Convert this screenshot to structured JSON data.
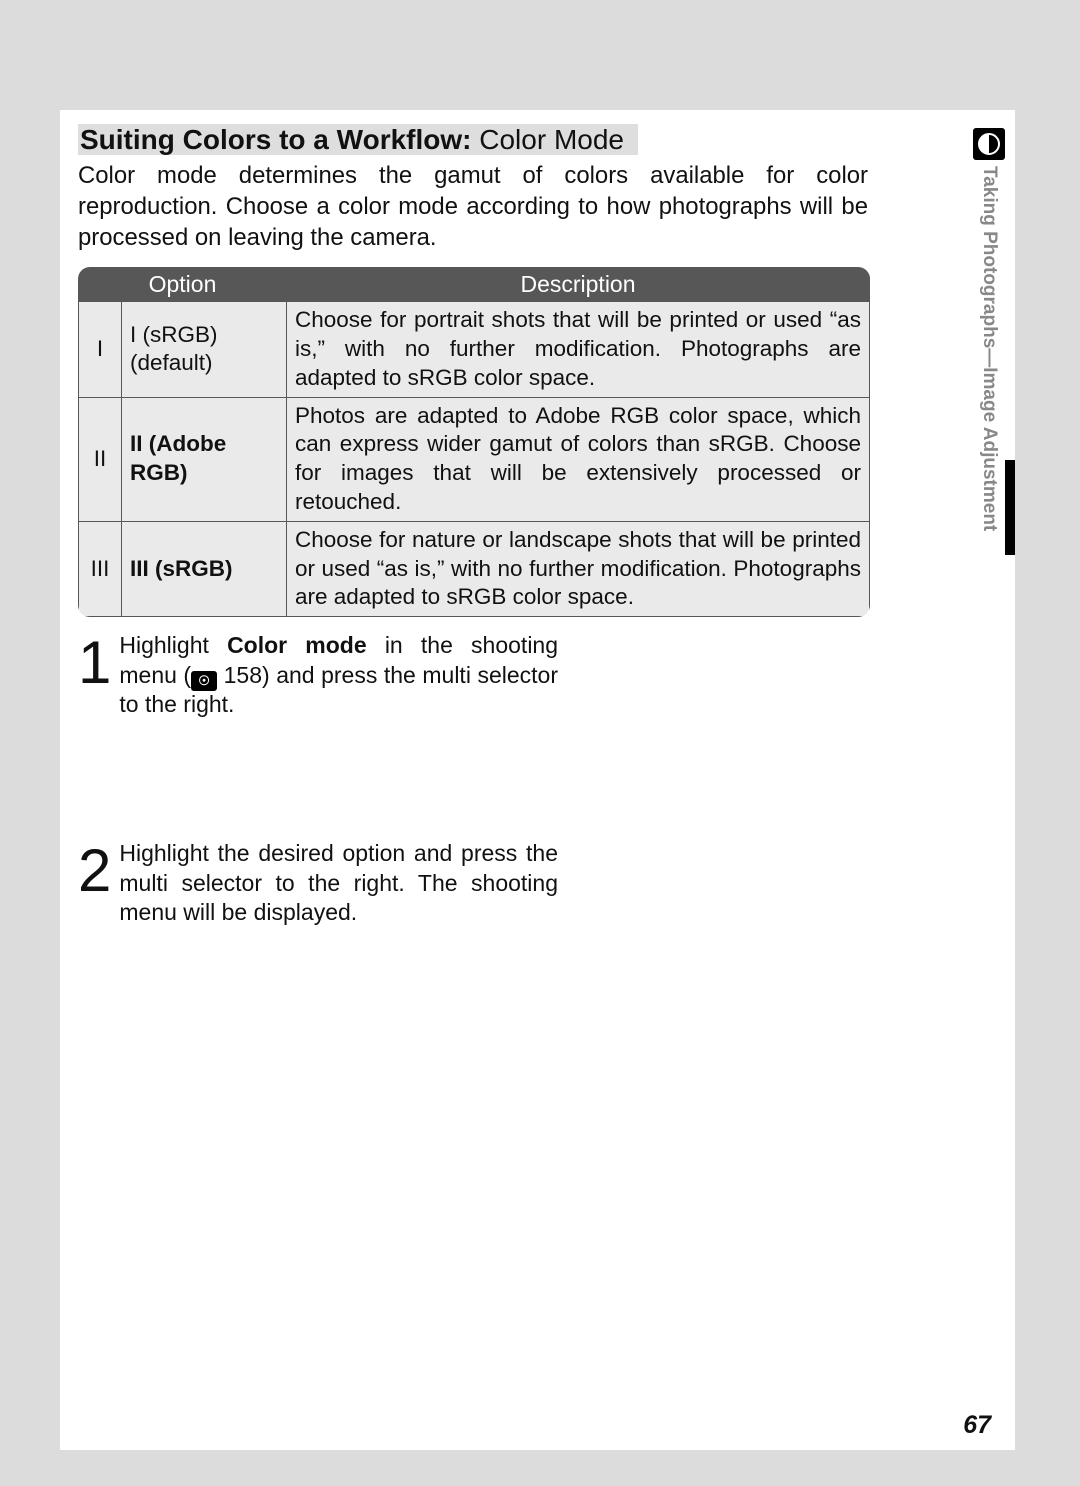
{
  "heading": {
    "bold": "Suiting Colors to a Workflow: ",
    "normal": "Color Mode"
  },
  "intro": "Color mode determines the gamut of colors available for color reproduction. Choose a color mode according to how photographs will be processed on leaving the camera.",
  "table": {
    "headers": {
      "option": "Option",
      "description": "Description"
    },
    "rows": [
      {
        "idx": "I",
        "optHtml": "I (sRGB) (default)",
        "desc": "Choose for portrait shots that will be printed or used “as is,” with no further modification.  Photographs are adapted to sRGB color space."
      },
      {
        "idx": "II",
        "optHtml": "<b>II (Adobe RGB)</b>",
        "desc": "Photos are adapted to Adobe RGB color space, which can express wider gamut of colors than sRGB.  Choose for images that will be extensively processed or retouched."
      },
      {
        "idx": "III",
        "optHtml": "<b>III  (sRGB)</b>",
        "desc": "Choose for nature or landscape shots that will be printed or used “as is,” with no further modification.  Photographs are adapted to sRGB color space."
      }
    ]
  },
  "steps": [
    {
      "n": "1",
      "html": "Highlight <span class=\"b\">Color mode</span> in the shooting menu (<span class=\"refglyph\">☉</span> 158) and press the multi selector to the right."
    },
    {
      "n": "2",
      "html": "Highlight the desired option and press the multi selector to the right.  The shooting menu will be displayed."
    }
  ],
  "sidebar": "Taking Photographs—Image Adjustment",
  "pageNumber": "67"
}
